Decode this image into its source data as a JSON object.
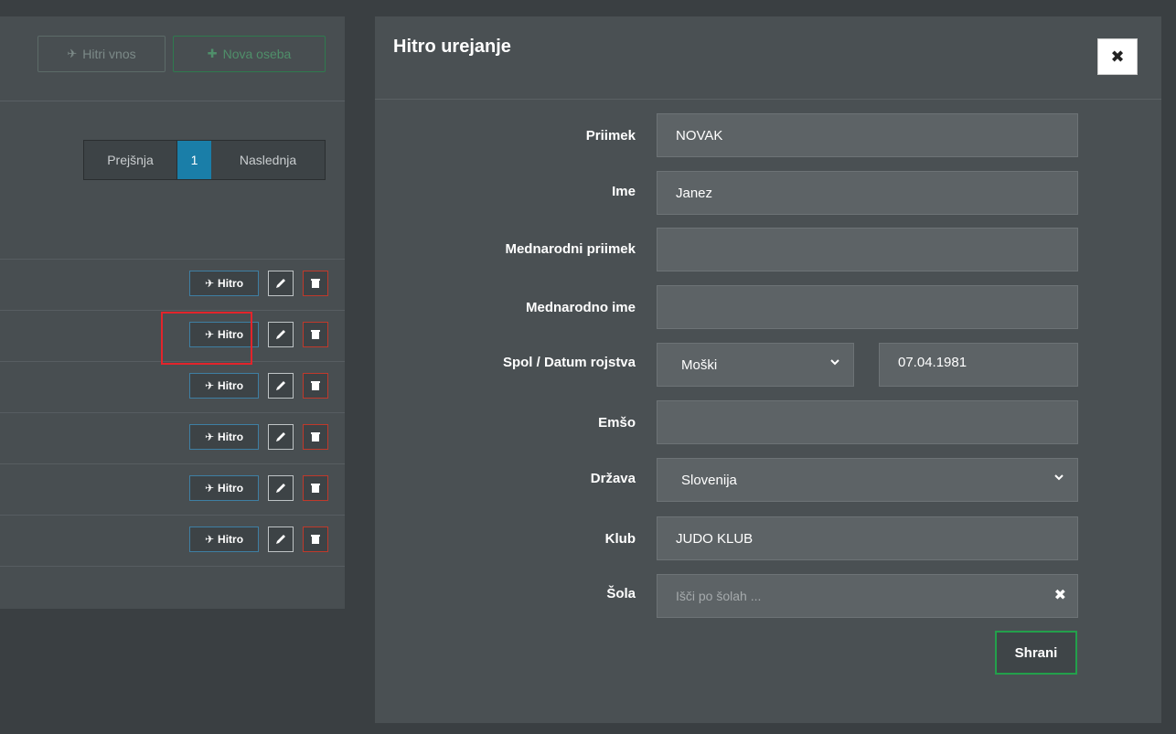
{
  "list": {
    "quick_entry_label": "Hitri vnos",
    "new_person_label": "Nova oseba",
    "pager": {
      "prev": "Prejšnja",
      "current": "1",
      "next": "Naslednja"
    },
    "row_action_label": "Hitro"
  },
  "modal": {
    "title": "Hitro urejanje",
    "close_glyph": "✖",
    "fields": {
      "surname": {
        "label": "Priimek",
        "value": "NOVAK"
      },
      "name": {
        "label": "Ime",
        "value": "Janez"
      },
      "intl_surname": {
        "label": "Mednarodni priimek",
        "value": ""
      },
      "intl_name": {
        "label": "Mednarodno ime",
        "value": ""
      },
      "gender_dob": {
        "label": "Spol / Datum rojstva",
        "gender": "Moški",
        "dob": "07.04.1981"
      },
      "emso": {
        "label": "Emšo",
        "value": ""
      },
      "country": {
        "label": "Država",
        "value": "Slovenija"
      },
      "club": {
        "label": "Klub",
        "value": "JUDO KLUB"
      },
      "school": {
        "label": "Šola",
        "placeholder": "Išči po šolah ..."
      }
    },
    "save_label": "Shrani"
  },
  "colors": {
    "accent_blue": "#1a7ea8",
    "save_green": "#23a04b",
    "delete_red": "#c0392b",
    "highlight_red": "#e3242b"
  },
  "icons": {
    "quick": "plane-icon",
    "new_person": "plus-icon",
    "edit": "pencil-icon",
    "delete": "trash-icon",
    "dropdown": "chevron-down-icon",
    "clear": "times-icon"
  }
}
